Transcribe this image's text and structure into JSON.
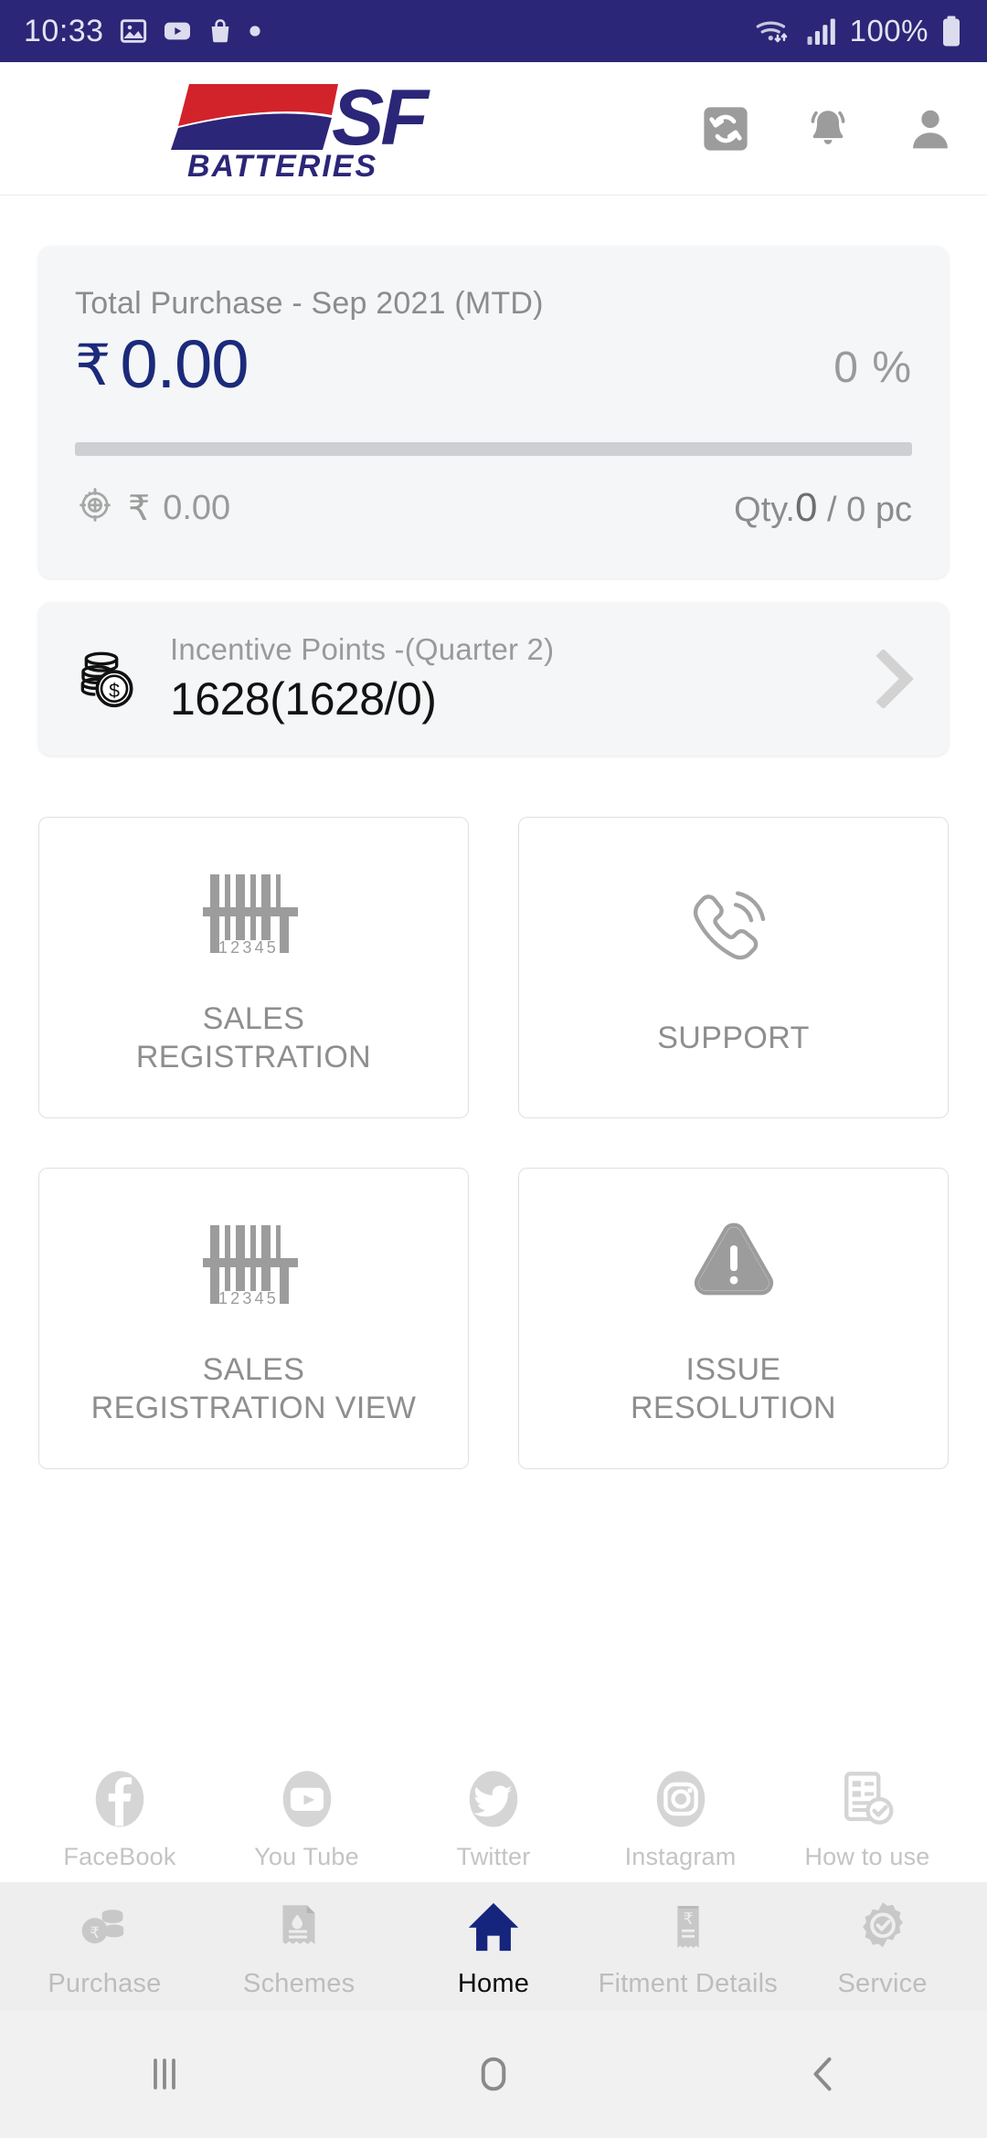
{
  "status_bar": {
    "time": "10:33",
    "battery_text": "100%",
    "left_icons": [
      "gallery-icon",
      "youtube-icon",
      "shopping-bag-icon",
      "dot-icon"
    ],
    "right_icons": [
      "wifi-icon",
      "signal-icon",
      "battery-icon"
    ],
    "background_color": "#2b2677"
  },
  "app_bar": {
    "logo_primary": "SF",
    "logo_secondary": "BATTERIES",
    "logo_red": "#d2232a",
    "logo_blue": "#2b2677",
    "icons": [
      {
        "name": "sync-icon",
        "label": "Sync"
      },
      {
        "name": "notification-bell-icon",
        "label": "Notifications"
      },
      {
        "name": "profile-icon",
        "label": "Profile"
      }
    ]
  },
  "purchase_card": {
    "title": "Total Purchase - Sep 2021 (MTD)",
    "currency_symbol": "₹",
    "amount": "0.00",
    "percent": "0 %",
    "progress_percent": 0,
    "target_icon": "target-icon",
    "target_currency": "₹",
    "target_amount": "0.00",
    "qty_prefix": "Qty.",
    "qty_current": "0",
    "qty_separator": " / ",
    "qty_total": "0 pc",
    "amount_color": "#1b2a7a"
  },
  "incentive_card": {
    "icon": "coins-icon",
    "label": "Incentive Points -(Quarter 2)",
    "value": "1628(1628/0)",
    "chevron": "chevron-right-icon"
  },
  "tiles": [
    {
      "icon": "barcode-icon",
      "line1": "SALES",
      "line2": "REGISTRATION"
    },
    {
      "icon": "phone-call-icon",
      "line1": "SUPPORT",
      "line2": ""
    },
    {
      "icon": "barcode-icon",
      "line1": "SALES",
      "line2": "REGISTRATION VIEW"
    },
    {
      "icon": "warning-triangle-icon",
      "line1": "ISSUE",
      "line2": "RESOLUTION"
    }
  ],
  "social_links": [
    {
      "icon": "facebook-icon",
      "label": "FaceBook"
    },
    {
      "icon": "youtube-icon",
      "label": "You Tube"
    },
    {
      "icon": "twitter-icon",
      "label": "Twitter"
    },
    {
      "icon": "instagram-icon",
      "label": "Instagram"
    },
    {
      "icon": "how-to-use-icon",
      "label": "How to use"
    }
  ],
  "bottom_nav": [
    {
      "icon": "coins-icon",
      "label": "Purchase",
      "active": false
    },
    {
      "icon": "schemes-document-icon",
      "label": "Schemes",
      "active": false
    },
    {
      "icon": "home-icon",
      "label": "Home",
      "active": true
    },
    {
      "icon": "receipt-icon",
      "label": "Fitment Details",
      "active": false
    },
    {
      "icon": "service-badge-icon",
      "label": "Service",
      "active": false
    }
  ],
  "android_nav": [
    {
      "icon": "recents-icon"
    },
    {
      "icon": "home-circle-icon"
    },
    {
      "icon": "back-icon"
    }
  ],
  "colors": {
    "brand_navy": "#2b2677",
    "brand_red": "#d2232a",
    "accent_value": "#1b2a7a",
    "muted_text": "#9a9a9a",
    "card_bg": "#f5f6f7"
  }
}
